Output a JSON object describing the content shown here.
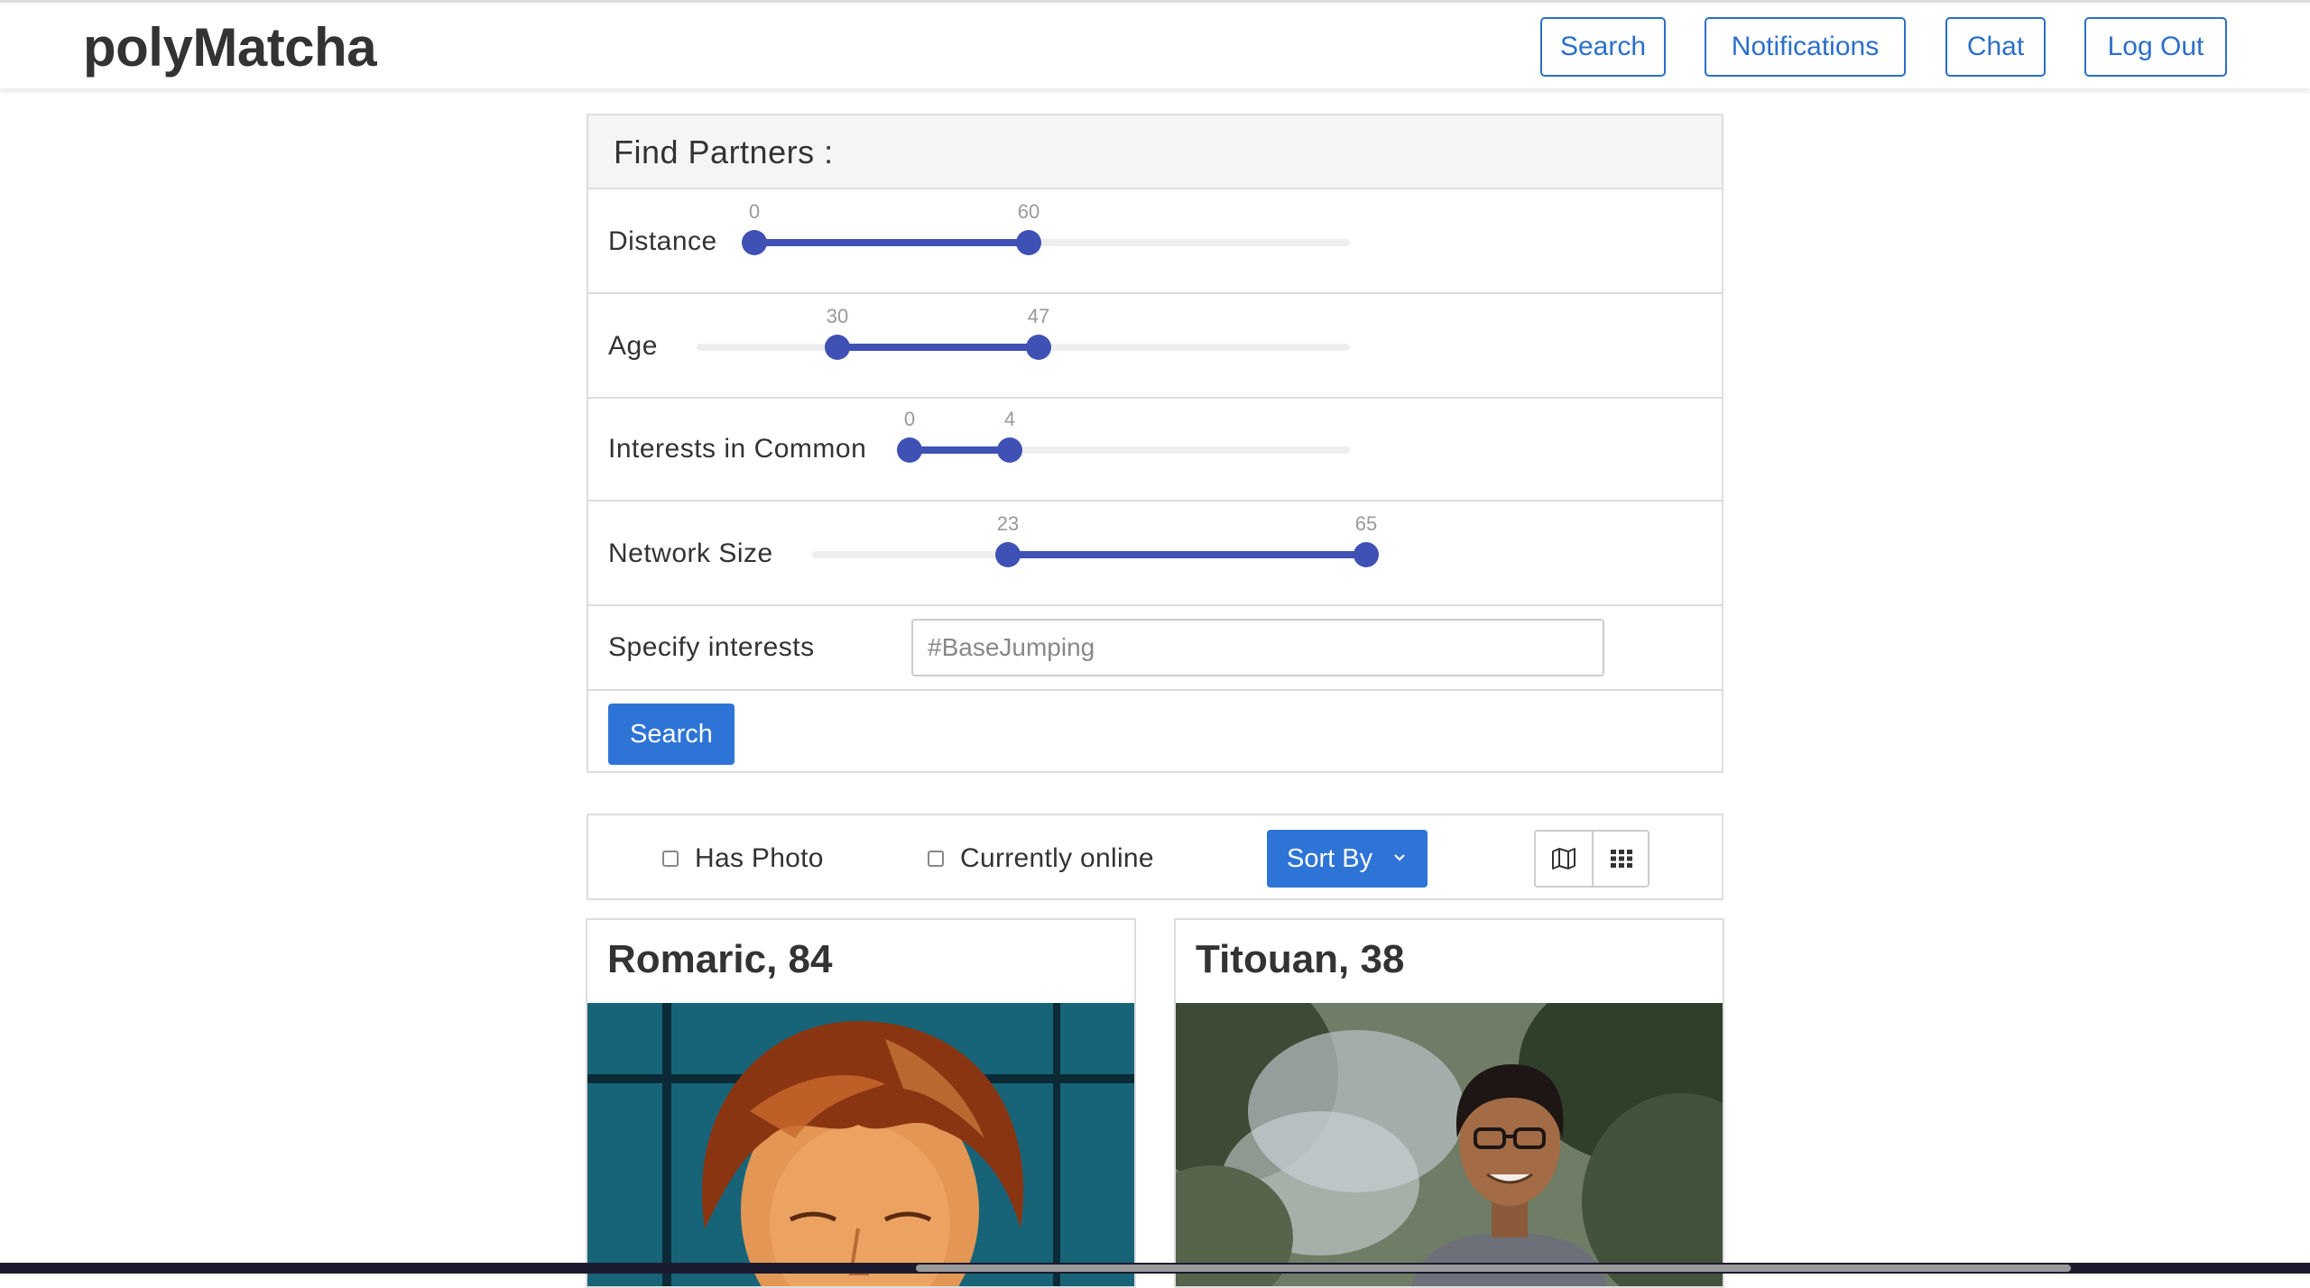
{
  "nav": {
    "brand": "polyMatcha",
    "search_label": "Search",
    "notifications_label": "Notifications",
    "chat_label": "Chat",
    "logout_label": "Log Out"
  },
  "colors": {
    "accent": "#2e74d6",
    "slider": "#3f51b5",
    "border": "#dddddd"
  },
  "filters": {
    "title": "Find Partners :",
    "distance": {
      "label": "Distance",
      "min": 0,
      "max": 60,
      "low_text": "0",
      "high_text": "60"
    },
    "age": {
      "label": "Age",
      "min": 30,
      "max": 47,
      "low_text": "30",
      "high_text": "47"
    },
    "interests": {
      "label": "Interests in Common",
      "min": 0,
      "max": 4,
      "low_text": "0",
      "high_text": "4"
    },
    "network": {
      "label": "Network Size",
      "min": 23,
      "max": 65,
      "low_text": "23",
      "high_text": "65"
    },
    "specify_label": "Specify interests",
    "interest_placeholder": "#BaseJumping",
    "search_button": "Search"
  },
  "toolbar": {
    "has_photo_label": "Has Photo",
    "has_photo_checked": false,
    "online_label": "Currently online",
    "online_checked": false,
    "sort_label": "Sort By",
    "map_view_icon": "map-icon",
    "grid_view_icon": "grid-icon"
  },
  "results": [
    {
      "title": "Romaric, 84"
    },
    {
      "title": "Titouan, 38"
    }
  ]
}
